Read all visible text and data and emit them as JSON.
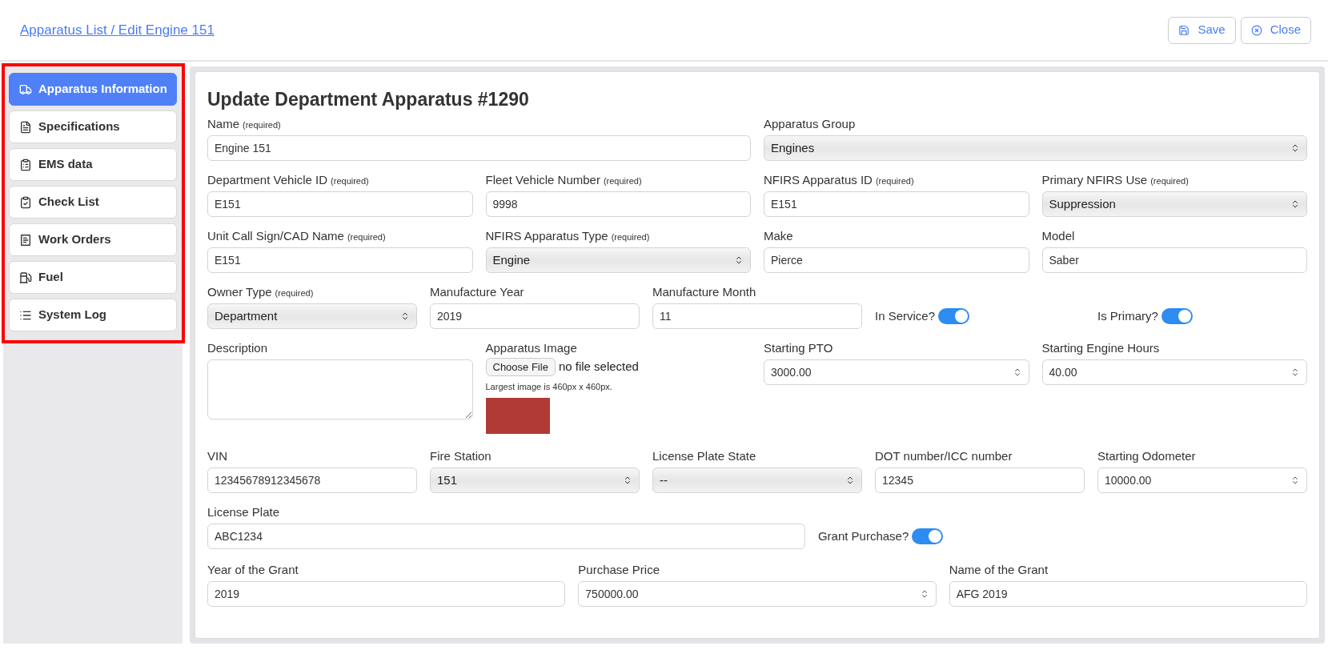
{
  "header": {
    "breadcrumb": "Apparatus List / Edit Engine 151",
    "buttons": [
      {
        "label": "Save",
        "kind": "save"
      },
      {
        "label": "Close",
        "kind": "close"
      }
    ]
  },
  "sidebar": {
    "items": [
      {
        "label": "Apparatus Information",
        "selected": true
      },
      {
        "label": "Specifications",
        "selected": false
      },
      {
        "label": "EMS data",
        "selected": false
      },
      {
        "label": "Check List",
        "selected": false
      },
      {
        "label": "Work Orders",
        "selected": false
      },
      {
        "label": "Fuel",
        "selected": false
      },
      {
        "label": "System Log",
        "selected": false
      }
    ]
  },
  "form": {
    "title": "Update Department Apparatus #1290",
    "rows": [
      [
        {
          "kind": "text",
          "label": "Name",
          "note": "(required)",
          "value": "Engine 151"
        },
        {
          "kind": "select",
          "label": "Apparatus Group",
          "value": "Engines"
        }
      ],
      [
        {
          "kind": "text",
          "label": "Department Vehicle ID",
          "note": "(required)",
          "value": "E151"
        },
        {
          "kind": "text",
          "label": "Fleet Vehicle Number",
          "note": "(required)",
          "value": "9998"
        },
        {
          "kind": "text",
          "label": "NFIRS Apparatus ID",
          "note": "(required)",
          "value": "E151"
        },
        {
          "kind": "select",
          "label": "Primary NFIRS Use",
          "note": "(required)",
          "value": "Suppression"
        }
      ],
      [
        {
          "kind": "text",
          "label": "Unit Call Sign/CAD Name",
          "note": "(required)",
          "value": "E151"
        },
        {
          "kind": "select",
          "label": "NFIRS Apparatus Type",
          "note": "(required)",
          "value": "Engine"
        },
        {
          "kind": "text",
          "label": "Make",
          "value": "Pierce"
        },
        {
          "kind": "text",
          "label": "Model",
          "value": "Saber"
        }
      ],
      [
        {
          "kind": "select",
          "label": "Owner Type",
          "note": "(required)",
          "value": "Department"
        },
        {
          "kind": "text",
          "label": "Manufacture Year",
          "value": "2019"
        },
        {
          "kind": "text",
          "label": "Manufacture Month",
          "value": "11"
        },
        {
          "kind": "toggle",
          "label": "In Service?",
          "on": true
        },
        {
          "kind": "toggle",
          "label": "Is Primary?",
          "on": true
        }
      ],
      [
        {
          "kind": "textarea",
          "label": "Description"
        },
        {
          "kind": "file",
          "label": "Apparatus Image",
          "button": "Choose File",
          "status": "no file selected",
          "hint": "Largest image is 460px x 460px."
        },
        {
          "kind": "number",
          "label": "Starting PTO",
          "value": "3000.00"
        },
        {
          "kind": "number",
          "label": "Starting Engine Hours",
          "value": "40.00"
        }
      ],
      [
        {
          "kind": "text",
          "label": "VIN",
          "value": "12345678912345678"
        },
        {
          "kind": "select",
          "label": "Fire Station",
          "value": "151"
        },
        {
          "kind": "select",
          "label": "License Plate State",
          "value": "--"
        },
        {
          "kind": "text",
          "label": "DOT number/ICC number",
          "value": "12345"
        },
        {
          "kind": "number",
          "label": "Starting Odometer",
          "value": "10000.00"
        }
      ],
      [
        {
          "kind": "text",
          "label": "License Plate",
          "value": "ABC1234"
        },
        {
          "kind": "toggle",
          "label": "Grant Purchase?",
          "on": true
        }
      ],
      [
        {
          "kind": "text",
          "label": "Year of the Grant",
          "value": "2019"
        },
        {
          "kind": "number",
          "label": "Purchase Price",
          "value": "750000.00"
        },
        {
          "kind": "text",
          "label": "Name of the Grant",
          "value": "AFG 2019"
        }
      ]
    ]
  }
}
